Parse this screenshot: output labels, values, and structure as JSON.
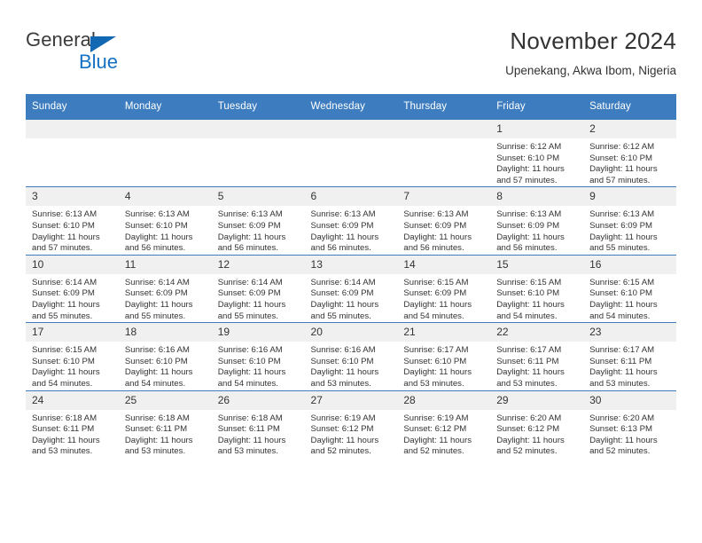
{
  "brand": {
    "name_part1": "General",
    "name_part2": "Blue",
    "accent_color": "#1471c4",
    "header_color": "#3c7cbf"
  },
  "header": {
    "title": "November 2024",
    "subtitle": "Upenekang, Akwa Ibom, Nigeria"
  },
  "calendar": {
    "weekday_headers": [
      "Sunday",
      "Monday",
      "Tuesday",
      "Wednesday",
      "Thursday",
      "Friday",
      "Saturday"
    ],
    "labels": {
      "sunrise": "Sunrise:",
      "sunset": "Sunset:",
      "daylight": "Daylight:"
    },
    "weeks": [
      [
        {
          "day": "",
          "empty": true
        },
        {
          "day": "",
          "empty": true
        },
        {
          "day": "",
          "empty": true
        },
        {
          "day": "",
          "empty": true
        },
        {
          "day": "",
          "empty": true
        },
        {
          "day": "1",
          "sunrise": "Sunrise: 6:12 AM",
          "sunset": "Sunset: 6:10 PM",
          "daylight_line1": "Daylight: 11 hours",
          "daylight_line2": "and 57 minutes."
        },
        {
          "day": "2",
          "sunrise": "Sunrise: 6:12 AM",
          "sunset": "Sunset: 6:10 PM",
          "daylight_line1": "Daylight: 11 hours",
          "daylight_line2": "and 57 minutes."
        }
      ],
      [
        {
          "day": "3",
          "sunrise": "Sunrise: 6:13 AM",
          "sunset": "Sunset: 6:10 PM",
          "daylight_line1": "Daylight: 11 hours",
          "daylight_line2": "and 57 minutes."
        },
        {
          "day": "4",
          "sunrise": "Sunrise: 6:13 AM",
          "sunset": "Sunset: 6:10 PM",
          "daylight_line1": "Daylight: 11 hours",
          "daylight_line2": "and 56 minutes."
        },
        {
          "day": "5",
          "sunrise": "Sunrise: 6:13 AM",
          "sunset": "Sunset: 6:09 PM",
          "daylight_line1": "Daylight: 11 hours",
          "daylight_line2": "and 56 minutes."
        },
        {
          "day": "6",
          "sunrise": "Sunrise: 6:13 AM",
          "sunset": "Sunset: 6:09 PM",
          "daylight_line1": "Daylight: 11 hours",
          "daylight_line2": "and 56 minutes."
        },
        {
          "day": "7",
          "sunrise": "Sunrise: 6:13 AM",
          "sunset": "Sunset: 6:09 PM",
          "daylight_line1": "Daylight: 11 hours",
          "daylight_line2": "and 56 minutes."
        },
        {
          "day": "8",
          "sunrise": "Sunrise: 6:13 AM",
          "sunset": "Sunset: 6:09 PM",
          "daylight_line1": "Daylight: 11 hours",
          "daylight_line2": "and 56 minutes."
        },
        {
          "day": "9",
          "sunrise": "Sunrise: 6:13 AM",
          "sunset": "Sunset: 6:09 PM",
          "daylight_line1": "Daylight: 11 hours",
          "daylight_line2": "and 55 minutes."
        }
      ],
      [
        {
          "day": "10",
          "sunrise": "Sunrise: 6:14 AM",
          "sunset": "Sunset: 6:09 PM",
          "daylight_line1": "Daylight: 11 hours",
          "daylight_line2": "and 55 minutes."
        },
        {
          "day": "11",
          "sunrise": "Sunrise: 6:14 AM",
          "sunset": "Sunset: 6:09 PM",
          "daylight_line1": "Daylight: 11 hours",
          "daylight_line2": "and 55 minutes."
        },
        {
          "day": "12",
          "sunrise": "Sunrise: 6:14 AM",
          "sunset": "Sunset: 6:09 PM",
          "daylight_line1": "Daylight: 11 hours",
          "daylight_line2": "and 55 minutes."
        },
        {
          "day": "13",
          "sunrise": "Sunrise: 6:14 AM",
          "sunset": "Sunset: 6:09 PM",
          "daylight_line1": "Daylight: 11 hours",
          "daylight_line2": "and 55 minutes."
        },
        {
          "day": "14",
          "sunrise": "Sunrise: 6:15 AM",
          "sunset": "Sunset: 6:09 PM",
          "daylight_line1": "Daylight: 11 hours",
          "daylight_line2": "and 54 minutes."
        },
        {
          "day": "15",
          "sunrise": "Sunrise: 6:15 AM",
          "sunset": "Sunset: 6:10 PM",
          "daylight_line1": "Daylight: 11 hours",
          "daylight_line2": "and 54 minutes."
        },
        {
          "day": "16",
          "sunrise": "Sunrise: 6:15 AM",
          "sunset": "Sunset: 6:10 PM",
          "daylight_line1": "Daylight: 11 hours",
          "daylight_line2": "and 54 minutes."
        }
      ],
      [
        {
          "day": "17",
          "sunrise": "Sunrise: 6:15 AM",
          "sunset": "Sunset: 6:10 PM",
          "daylight_line1": "Daylight: 11 hours",
          "daylight_line2": "and 54 minutes."
        },
        {
          "day": "18",
          "sunrise": "Sunrise: 6:16 AM",
          "sunset": "Sunset: 6:10 PM",
          "daylight_line1": "Daylight: 11 hours",
          "daylight_line2": "and 54 minutes."
        },
        {
          "day": "19",
          "sunrise": "Sunrise: 6:16 AM",
          "sunset": "Sunset: 6:10 PM",
          "daylight_line1": "Daylight: 11 hours",
          "daylight_line2": "and 54 minutes."
        },
        {
          "day": "20",
          "sunrise": "Sunrise: 6:16 AM",
          "sunset": "Sunset: 6:10 PM",
          "daylight_line1": "Daylight: 11 hours",
          "daylight_line2": "and 53 minutes."
        },
        {
          "day": "21",
          "sunrise": "Sunrise: 6:17 AM",
          "sunset": "Sunset: 6:10 PM",
          "daylight_line1": "Daylight: 11 hours",
          "daylight_line2": "and 53 minutes."
        },
        {
          "day": "22",
          "sunrise": "Sunrise: 6:17 AM",
          "sunset": "Sunset: 6:11 PM",
          "daylight_line1": "Daylight: 11 hours",
          "daylight_line2": "and 53 minutes."
        },
        {
          "day": "23",
          "sunrise": "Sunrise: 6:17 AM",
          "sunset": "Sunset: 6:11 PM",
          "daylight_line1": "Daylight: 11 hours",
          "daylight_line2": "and 53 minutes."
        }
      ],
      [
        {
          "day": "24",
          "sunrise": "Sunrise: 6:18 AM",
          "sunset": "Sunset: 6:11 PM",
          "daylight_line1": "Daylight: 11 hours",
          "daylight_line2": "and 53 minutes."
        },
        {
          "day": "25",
          "sunrise": "Sunrise: 6:18 AM",
          "sunset": "Sunset: 6:11 PM",
          "daylight_line1": "Daylight: 11 hours",
          "daylight_line2": "and 53 minutes."
        },
        {
          "day": "26",
          "sunrise": "Sunrise: 6:18 AM",
          "sunset": "Sunset: 6:11 PM",
          "daylight_line1": "Daylight: 11 hours",
          "daylight_line2": "and 53 minutes."
        },
        {
          "day": "27",
          "sunrise": "Sunrise: 6:19 AM",
          "sunset": "Sunset: 6:12 PM",
          "daylight_line1": "Daylight: 11 hours",
          "daylight_line2": "and 52 minutes."
        },
        {
          "day": "28",
          "sunrise": "Sunrise: 6:19 AM",
          "sunset": "Sunset: 6:12 PM",
          "daylight_line1": "Daylight: 11 hours",
          "daylight_line2": "and 52 minutes."
        },
        {
          "day": "29",
          "sunrise": "Sunrise: 6:20 AM",
          "sunset": "Sunset: 6:12 PM",
          "daylight_line1": "Daylight: 11 hours",
          "daylight_line2": "and 52 minutes."
        },
        {
          "day": "30",
          "sunrise": "Sunrise: 6:20 AM",
          "sunset": "Sunset: 6:13 PM",
          "daylight_line1": "Daylight: 11 hours",
          "daylight_line2": "and 52 minutes."
        }
      ]
    ]
  }
}
